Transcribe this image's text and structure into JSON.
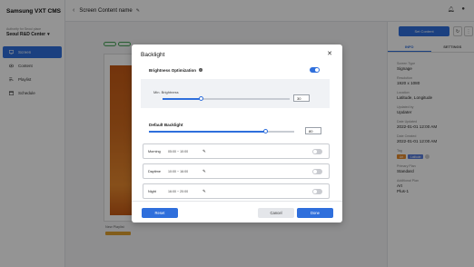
{
  "app": {
    "brand": "Samsung VXT CMS"
  },
  "sidebar": {
    "org_label": "Authority for Seoul place",
    "org_name": "Seoul R&D Center",
    "items": [
      {
        "label": "Screen",
        "icon": "screen-icon",
        "active": true
      },
      {
        "label": "Content",
        "icon": "content-icon",
        "active": false
      },
      {
        "label": "Playlist",
        "icon": "playlist-icon",
        "active": false
      },
      {
        "label": "Schedule",
        "icon": "schedule-icon",
        "active": false
      }
    ]
  },
  "header": {
    "back_icon": "chevron-left-icon",
    "title": "Screen Content name"
  },
  "main": {
    "new_playlist_label": "New Playlist"
  },
  "right_panel": {
    "set_content_label": "Set Content",
    "tabs": [
      {
        "label": "INFO",
        "active": true
      },
      {
        "label": "SETTINGS",
        "active": false
      }
    ],
    "props": [
      {
        "label": "Screen Type",
        "value": "Signage"
      },
      {
        "label": "Resolution",
        "value": "1920 x 1080"
      },
      {
        "label": "Location",
        "value": "Latitude, Longitude"
      },
      {
        "label": "Updated by",
        "value": "Updater"
      },
      {
        "label": "Date Updated",
        "value": "2022-01-01 12:00 AM"
      },
      {
        "label": "Date Created",
        "value": "2022-01-01 12:00 AM"
      }
    ],
    "tag_label": "Tag",
    "tags": [
      {
        "label": "Art",
        "color": "#e58a2b"
      },
      {
        "label": "Latitude",
        "color": "#5a7fdc"
      }
    ],
    "primary_label": "Primary Plan",
    "primary_value": "Standard",
    "additional_label": "Additional Plan",
    "additional_values": [
      "Art",
      "Plus-1"
    ]
  },
  "modal": {
    "title": "Backlight",
    "brightness_optimization_label": "Brightness Optimization",
    "brightness_optimization_on": true,
    "min_brightness_label": "Min. Brightness",
    "min_brightness_value": "30",
    "min_brightness_fraction": 0.3,
    "default_backlight_label": "Default Backlight",
    "default_backlight_value": "80",
    "default_backlight_fraction": 0.8,
    "schedules": [
      {
        "name": "Morning",
        "time": "05:00 ~ 10:00",
        "on": false
      },
      {
        "name": "Daytime",
        "time": "10:00 ~ 16:00",
        "on": false
      },
      {
        "name": "Night",
        "time": "16:00 ~ 20:00",
        "on": false
      }
    ],
    "reset_label": "Reset",
    "cancel_label": "Cancel",
    "done_label": "Done"
  },
  "colors": {
    "accent": "#2f6fdc",
    "toggle_off": "#c9cbd0"
  }
}
